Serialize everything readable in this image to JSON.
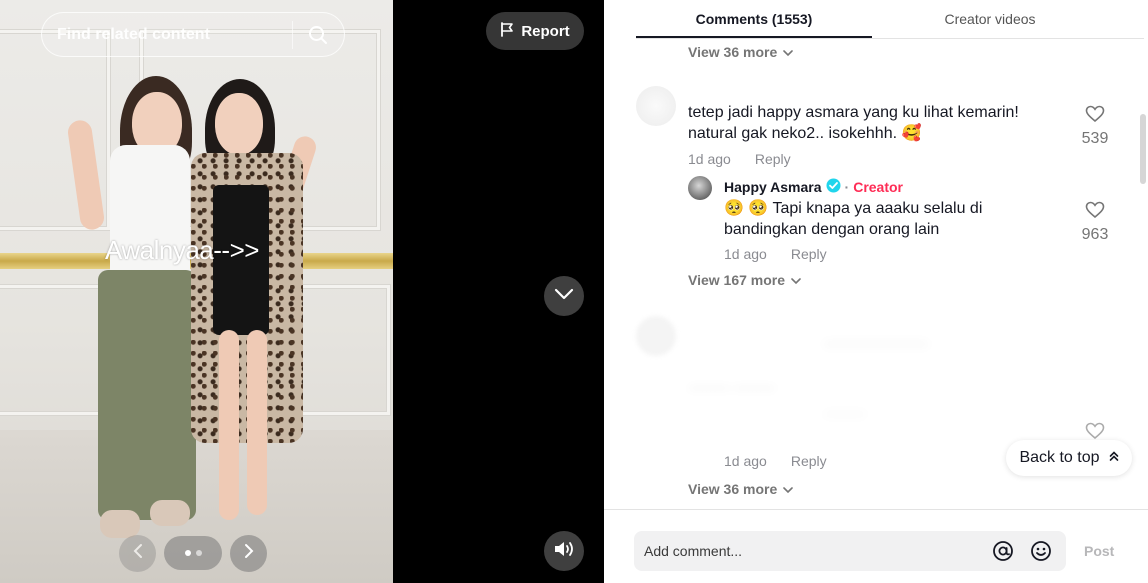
{
  "video": {
    "search_placeholder": "Find related content",
    "overlay_text": "Awalnyaa-->>",
    "report_label": "Report",
    "icons": {
      "search": "search-icon",
      "flag": "flag-icon",
      "next": "chevron-down-icon",
      "volume": "volume-icon",
      "prev_image": "chevron-left-icon",
      "next_image": "chevron-right-icon"
    },
    "carousel_pages": 2,
    "carousel_current": 1
  },
  "tabs": [
    {
      "label": "Comments (1553)",
      "active": true
    },
    {
      "label": "Creator videos",
      "active": false
    }
  ],
  "comments": {
    "view_more_top": "View 36 more",
    "items": [
      {
        "text": "tetep jadi happy asmara yang ku lihat kemarin! natural gak neko2.. isokehhh. 🥰",
        "time": "1d ago",
        "reply_label": "Reply",
        "likes": "539",
        "reply": {
          "author": "Happy Asmara",
          "verified": true,
          "badge": "Creator",
          "text": "🥺 🥺 Tapi knapa ya aaaku selalu di bandingkan dengan orang lain",
          "time": "1d ago",
          "reply_label": "Reply",
          "likes": "963"
        },
        "view_more": "View 167 more"
      },
      {
        "text": "",
        "time": "1d ago",
        "reply_label": "Reply",
        "likes": "",
        "reply": {
          "time": "1d ago",
          "reply_label": "Reply"
        },
        "view_more": "View 36 more"
      }
    ]
  },
  "back_to_top": "Back to top",
  "composer": {
    "placeholder": "Add comment...",
    "post_label": "Post",
    "icons": [
      "at-icon",
      "emoji-icon"
    ]
  },
  "colors": {
    "creator_badge": "#fe2c55",
    "verified": "#20d5ec",
    "text": "#161823",
    "muted": "#8a8b91"
  }
}
